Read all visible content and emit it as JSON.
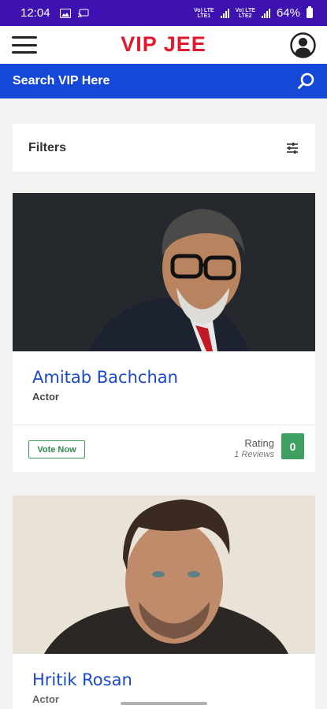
{
  "status_bar": {
    "time": "12:04",
    "network_1": "Vo) LTE",
    "network_1_sub": "LTE1",
    "network_2": "Vo) LTE",
    "network_2_sub": "LTE2",
    "battery": "64%"
  },
  "header": {
    "logo": "VIP JEE"
  },
  "search": {
    "placeholder": "Search VIP Here"
  },
  "filters": {
    "title": "Filters"
  },
  "vips": [
    {
      "name": "Amitab Bachchan",
      "role": "Actor",
      "vote_label": "Vote Now",
      "rating_label": "Rating",
      "reviews": "1 Reviews",
      "rating": "0"
    },
    {
      "name": "Hritik Rosan",
      "role": "Actor"
    }
  ],
  "colors": {
    "status_bar": "#3d12b0",
    "search_bar": "#1648d8",
    "logo": "#e3182d",
    "name": "#1a47cc",
    "rating_badge": "#3ea060"
  }
}
